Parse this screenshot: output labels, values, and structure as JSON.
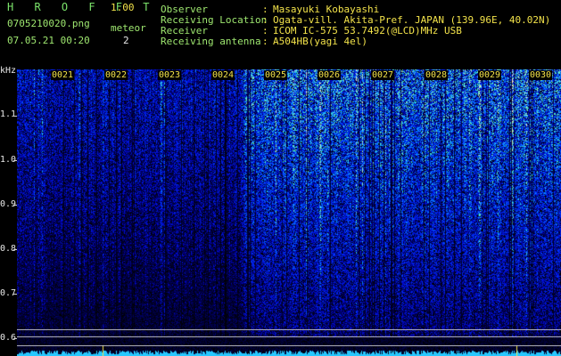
{
  "app": {
    "logo": "H R O F F T",
    "version": "1.00"
  },
  "file": {
    "name": "0705210020.png",
    "datetime": "07.05.21 00:20"
  },
  "meteor": {
    "label": "meteor",
    "count": "2"
  },
  "info": [
    {
      "key": "Observer",
      "value": "Masayuki Kobayashi"
    },
    {
      "key": "Receiving Location",
      "value": "Ogata-vill. Akita-Pref. JAPAN (139.96E, 40.02N)"
    },
    {
      "key": "Receiver",
      "value": "ICOM IC-575 53.7492(@LCD)MHz USB"
    },
    {
      "key": "Receiving antenna",
      "value": "A504HB(yagi 4el)"
    }
  ],
  "yaxis": {
    "unit": "kHz",
    "ticks": [
      "1.1",
      "1.0",
      "0.9",
      "0.8",
      "0.7",
      "0.6"
    ]
  },
  "minute_marks": [
    "0021",
    "0022",
    "0023",
    "0024",
    "0025",
    "0026",
    "0027",
    "0028",
    "0029",
    "0030"
  ],
  "colors": {
    "background": "#000000",
    "accent_yellow": "#f2e24a",
    "accent_green": "#9fe870"
  }
}
